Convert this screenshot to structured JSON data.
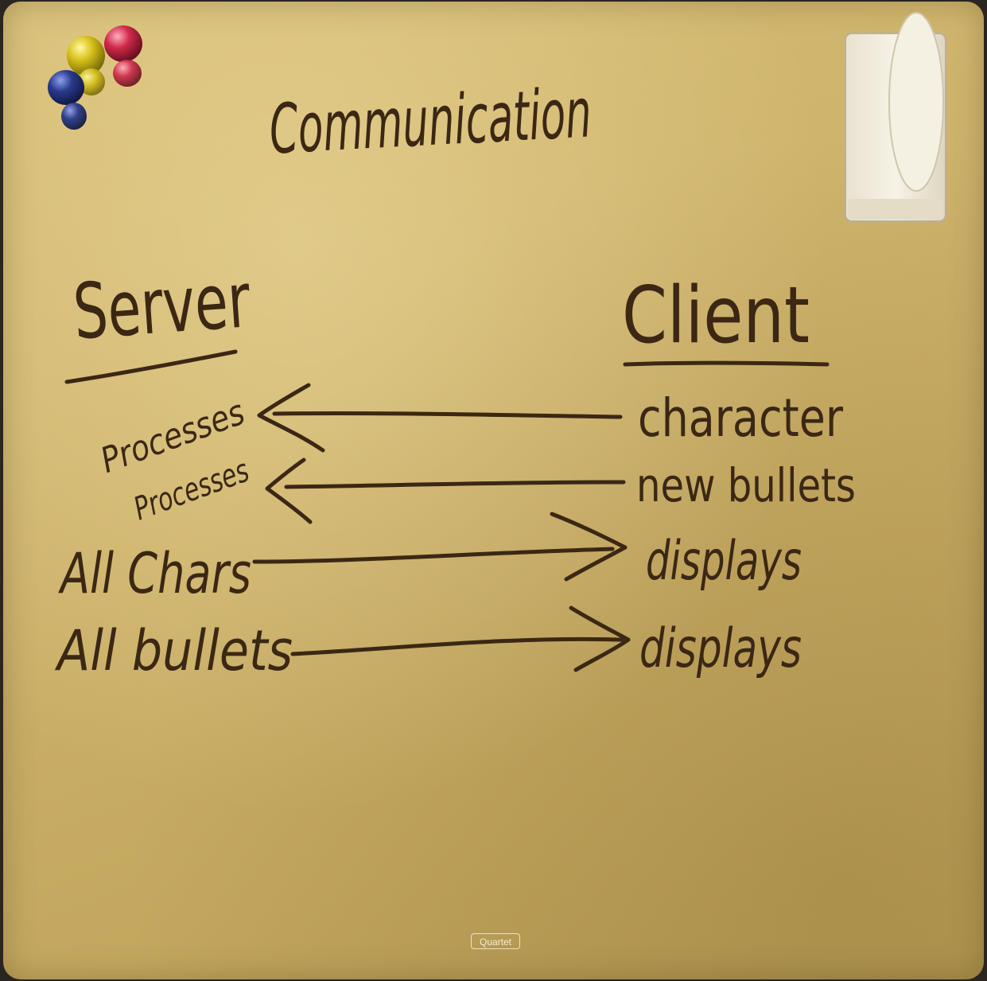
{
  "title": "Communication",
  "left_column": {
    "heading": "Server",
    "items": [
      "Processes",
      "Processes",
      "All Chars",
      "All bullets"
    ]
  },
  "right_column": {
    "heading": "Client",
    "items": [
      "character",
      "new bullets",
      "displays",
      "displays"
    ]
  },
  "arrows": [
    {
      "from": "character",
      "to": "Processes",
      "direction": "client-to-server"
    },
    {
      "from": "new bullets",
      "to": "Processes",
      "direction": "client-to-server"
    },
    {
      "from": "All Chars",
      "to": "displays",
      "direction": "server-to-client"
    },
    {
      "from": "All bullets",
      "to": "displays",
      "direction": "server-to-client"
    }
  ],
  "brand": "Quartet",
  "colors": {
    "board": "#cdb26a",
    "ink": "#3b2714",
    "magnet_blue": "#2a3a8c",
    "magnet_yellow": "#d8c21a",
    "magnet_red": "#d02a4a",
    "eraser": "#f1ede0"
  }
}
